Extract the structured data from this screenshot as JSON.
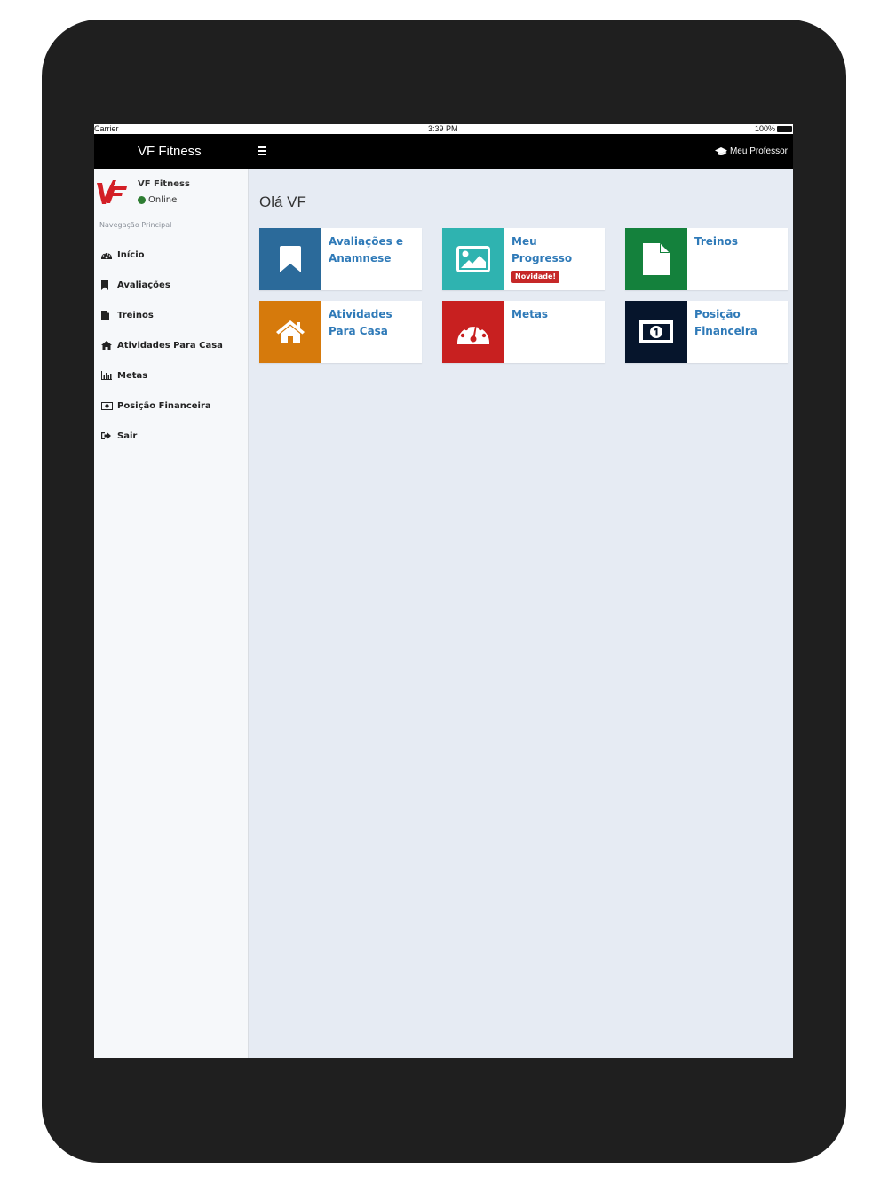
{
  "status_bar": {
    "carrier": "Carrier",
    "time": "3:39 PM",
    "battery": "100%"
  },
  "navbar": {
    "brand": "VF Fitness",
    "professor_link": "Meu Professor"
  },
  "sidebar": {
    "user_name": "VF Fitness",
    "user_status": "Online",
    "nav_header": "Navegação Principal",
    "items": [
      {
        "label": "Início",
        "icon": "dashboard-icon"
      },
      {
        "label": "Avaliações",
        "icon": "bookmark-icon"
      },
      {
        "label": "Treinos",
        "icon": "file-icon"
      },
      {
        "label": "Atividades Para Casa",
        "icon": "home-icon"
      },
      {
        "label": "Metas",
        "icon": "bar-chart-icon"
      },
      {
        "label": "Posição Financeira",
        "icon": "money-icon"
      },
      {
        "label": "Sair",
        "icon": "sign-out-icon"
      }
    ]
  },
  "main": {
    "greeting": "Olá VF",
    "tiles": [
      {
        "label": "Avaliações e Anamnese",
        "color": "#2b6a9a",
        "icon": "bookmark-icon"
      },
      {
        "label": "Meu Progresso",
        "badge": "Novidade!",
        "color": "#2fb3b0",
        "icon": "picture-icon"
      },
      {
        "label": "Treinos",
        "color": "#14813c",
        "icon": "file-icon"
      },
      {
        "label": "Atividades Para Casa",
        "color": "#d67a0c",
        "icon": "home-icon"
      },
      {
        "label": "Metas",
        "color": "#c82020",
        "icon": "dashboard-icon"
      },
      {
        "label": "Posição Financeira",
        "color": "#06152c",
        "icon": "money-icon"
      }
    ]
  }
}
